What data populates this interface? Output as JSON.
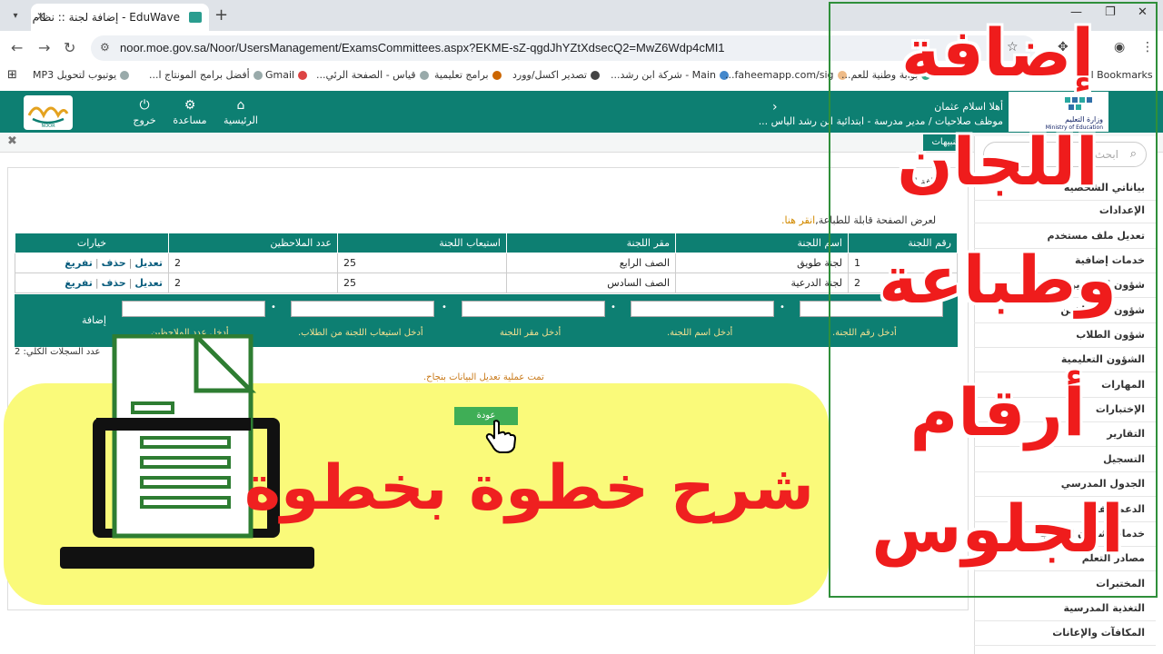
{
  "browser": {
    "tab_title": "EduWave - إضافة لجنة :: نظام نور",
    "url": "noor.moe.gov.sa/Noor/UsersManagement/ExamsCommittees.aspx?EKME-sZ-qgdJhYZtXdsecQ2=MwZ6Wdp4cMI1",
    "bookmarks": [
      "يوتيوب لتحويل MP3",
      "أفضل برامج المونتاج ا...",
      "Gmail",
      "قياس - الصفحة الرئي...",
      "برامج تعليمية",
      "تصدير اكسل/وورد",
      "Main - شركة ابن رشد...",
      "faheemapp.com/sig...",
      "بوابة وطنية للعم...",
      "All Bookmarks"
    ]
  },
  "header": {
    "nav": [
      "الرئيسية",
      "مساعدة",
      "خروج"
    ],
    "greeting": "أهلا  اسلام عثمان",
    "role": "موظف صلاحيات / مدير مدرسة - ابتدائية ابن رشد الياس ...",
    "ministry": "وزارة التعليم",
    "ministry_en": "Ministry of Education",
    "noor_brand": "NOOR",
    "alerts": "التنبيهات"
  },
  "sidebar": {
    "search_placeholder": "ابحث",
    "items": [
      "بياناتي الشخصية",
      "الإعدادات",
      "تعديل ملف مستخدم",
      "خدمات إضافية",
      "شؤون المعلمين",
      "شؤون الموظفين",
      "شؤون الطلاب",
      "الشؤون التعليمية",
      "المهارات",
      "الإختبارات",
      "التقارير",
      "التسجيل",
      "الجدول المدرسي",
      "الدعم الفني",
      "خدمات شؤون الطلاب",
      "مصادر التعلم",
      "المختبرات",
      "التغذية المدرسية",
      "المكافآت والإعانات"
    ]
  },
  "main": {
    "page_heading": "إضافة لجنة",
    "print_text": "لعرض الصفحة قابلة للطباعة,",
    "print_link": "انقر هنا.",
    "columns": [
      "رقم اللجنة",
      "اسم اللجنة",
      "مقر اللجنة",
      "استيعاب اللجنة",
      "عدد الملاحظين",
      "خيارات"
    ],
    "rows": [
      {
        "num": "1",
        "name": "لجنة طويق",
        "location": "الصف الرابع",
        "capacity": "25",
        "observers": "2"
      },
      {
        "num": "2",
        "name": "لجنة الدرعية",
        "location": "الصف السادس",
        "capacity": "25",
        "observers": "2"
      }
    ],
    "row_actions": {
      "edit": "تعديل",
      "delete": "حذف",
      "empty": "تفريغ"
    },
    "add_label": "إضافة",
    "hints": [
      "أدخل رقم اللجنة.",
      "أدخل اسم اللجنة.",
      "أدخل مقر اللجنة",
      "أدخل استيعاب اللجنة من الطلاب.",
      "أدخل عدد الملاحظين"
    ],
    "total_records": "عدد السجلات الكلي: 2",
    "success_msg": "تمت عملية تعديل البيانات بنجاح.",
    "back_button": "عودة"
  },
  "overlay": {
    "subtitle": "شرح خطوة بخطوة",
    "title_lines": [
      "إضافة",
      "اللجان",
      "وطباعة",
      "أرقام",
      "الجلوس"
    ]
  },
  "colors": {
    "noor_green": "#0d7f72",
    "overlay_red": "#ef2020",
    "overlay_yellow": "#fafa7a"
  }
}
